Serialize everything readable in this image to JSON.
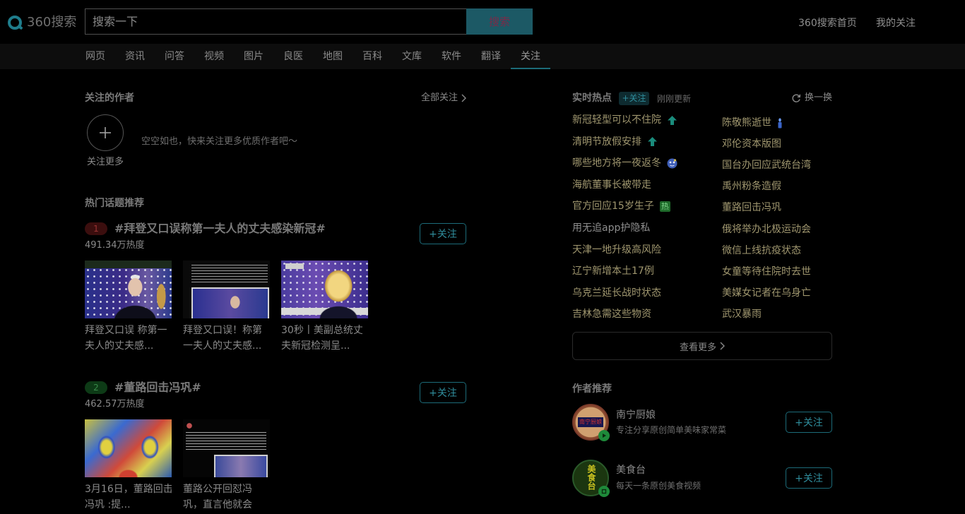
{
  "header": {
    "logo_text": "360搜索",
    "search_placeholder": "搜索一下",
    "search_button": "搜索",
    "home_link": "360搜索首页",
    "my_follow_link": "我的关注"
  },
  "nav": {
    "items": [
      "网页",
      "资讯",
      "问答",
      "视频",
      "图片",
      "良医",
      "地图",
      "百科",
      "文库",
      "软件",
      "翻译",
      "关注"
    ],
    "active_index": 11
  },
  "followed_authors": {
    "title": "关注的作者",
    "all_label": "全部关注",
    "add_more_label": "关注更多",
    "empty_text": "空空如也，快来关注更多优质作者吧～"
  },
  "hot_topics": {
    "title": "热门话题推荐",
    "topics": [
      {
        "rank": "1",
        "title": "#拜登又口误称第一夫人的丈夫感染新冠#",
        "heat": "491.34万热度",
        "follow_label": "+关注",
        "videos": [
          {
            "caption_lines": [
              "拜登又口误 称第一",
              "夫人的丈夫感..."
            ]
          },
          {
            "caption_lines": [
              "拜登又口误！称第",
              "一夫人的丈夫感..."
            ]
          },
          {
            "caption_lines": [
              "30秒丨美副总统丈",
              "夫新冠检测呈..."
            ]
          }
        ]
      },
      {
        "rank": "2",
        "title": "#董路回击冯巩#",
        "heat": "462.57万热度",
        "follow_label": "+关注",
        "videos": [
          {
            "caption_lines": [
              "3月16日，董路回击",
              "冯巩 :提..."
            ]
          },
          {
            "caption_lines": [
              "董路公开回怼冯",
              "巩，直言他就会"
            ]
          }
        ]
      }
    ]
  },
  "realtime_hot": {
    "title": "实时热点",
    "follow_label": "+关注",
    "updated_label": "刚刚更新",
    "refresh_label": "换一换",
    "left": [
      {
        "text": "新冠轻型可以不住院",
        "icon": "up-arrow-icon"
      },
      {
        "text": "清明节放假安排",
        "icon": "up-arrow-icon"
      },
      {
        "text": "哪些地方将一夜返冬",
        "icon": "weather-icon"
      },
      {
        "text": "海航董事长被带走"
      },
      {
        "text": "官方回应15岁生子",
        "icon": "hot-badge",
        "badge_text": "热"
      },
      {
        "text": "用无追app护隐私",
        "color": "#8e8e8e"
      },
      {
        "text": "天津一地升级高风险"
      },
      {
        "text": "辽宁新增本土17例"
      },
      {
        "text": "乌克兰延长战时状态"
      },
      {
        "text": "吉林急需这些物资"
      }
    ],
    "right": [
      {
        "text": "陈敬熊逝世",
        "icon": "candle-icon"
      },
      {
        "text": "邓伦资本版图"
      },
      {
        "text": "国台办回应武统台湾"
      },
      {
        "text": "禹州粉条造假"
      },
      {
        "text": "董路回击冯巩"
      },
      {
        "text": "俄将举办北极运动会"
      },
      {
        "text": "微信上线抗疫状态"
      },
      {
        "text": "女童等待住院时去世"
      },
      {
        "text": "美媒女记者在乌身亡"
      },
      {
        "text": "武汉暴雨"
      }
    ],
    "more_label": "查看更多"
  },
  "author_recommend": {
    "title": "作者推荐",
    "authors": [
      {
        "name": "南宁厨娘",
        "desc": "专注分享原创简单美味家常菜",
        "follow_label": "+关注",
        "badge_icon": "play-badge-icon"
      },
      {
        "name": "美食台",
        "desc": "每天一条原创美食视频",
        "follow_label": "+关注",
        "badge_icon": "video-badge-icon"
      }
    ]
  },
  "colors": {
    "background": "#000000",
    "accent": "#1c6b79",
    "accent_text": "#2f8d9c",
    "hot_item": "#a0976f",
    "rank_1": "#9a3434",
    "rank_2": "#3a8a4a"
  }
}
